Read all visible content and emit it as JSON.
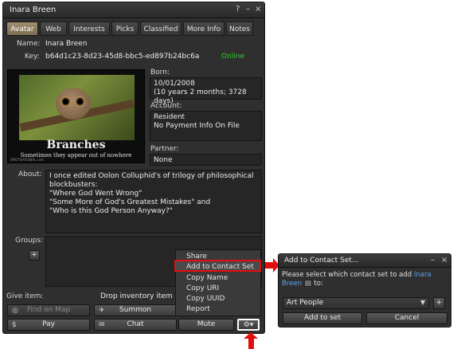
{
  "profile": {
    "title": "Inara Breen",
    "controls": {
      "help": "?",
      "minimize": "–",
      "close": "×"
    },
    "tabs": [
      "Avatar",
      "Web",
      "Interests",
      "Picks",
      "Classified",
      "More Info",
      "Notes"
    ],
    "active_tab": "Avatar",
    "name_label": "Name:",
    "name_value": "Inara Breen",
    "key_label": "Key:",
    "key_value": "b64d1c23-8d23-45d8-bbc5-ed897b24bc6a",
    "status": "Online",
    "photo": {
      "title": "Branches",
      "subtitle": "Sometimes they appear out of nowhere",
      "watermark": "EMOTIVATIONAL.com"
    },
    "born_label": "Born:",
    "born_line1": "10/01/2008",
    "born_line2": "(10 years 2 months; 3728 days)",
    "account_label": "Account:",
    "account_line1": "Resident",
    "account_line2": "No Payment Info On File",
    "partner_label": "Partner:",
    "partner_value": "None",
    "about_label": "About:",
    "about_lines": [
      "I once edited Oolon Colluphid's  of  trilogy of philosophical",
      "blockbusters:",
      "\"Where God Went Wrong\"",
      "\"Some More of God's Greatest Mistakes\" and",
      "\"Who is this God Person Anyway?\""
    ],
    "groups_label": "Groups:",
    "add_group": "+",
    "give_item_label": "Give item:",
    "drop_text": "Drop inventory item he",
    "buttons": {
      "find_on_map": "Find on Map",
      "summon": "Summon",
      "pay": "Pay",
      "chat": "Chat",
      "mute": "Mute"
    }
  },
  "menu": {
    "items": [
      "Share",
      "Add to Contact Set",
      "Copy Name",
      "Copy URI",
      "Copy UUID",
      "Report"
    ]
  },
  "dialog": {
    "title": "Add to Contact Set...",
    "minimize": "–",
    "close": "×",
    "prompt_prefix": "Please select which contact set to add",
    "prompt_name": "Inara",
    "prompt_name2": "Breen",
    "prompt_suffix": "to:",
    "selected_set": "Art People",
    "add_button": "Add to set",
    "cancel_button": "Cancel",
    "plus": "+"
  },
  "colors": {
    "highlight": "#e30d0d",
    "online": "#37cc37",
    "link": "#5ea6f0",
    "active_tab": "#8e7e60"
  }
}
